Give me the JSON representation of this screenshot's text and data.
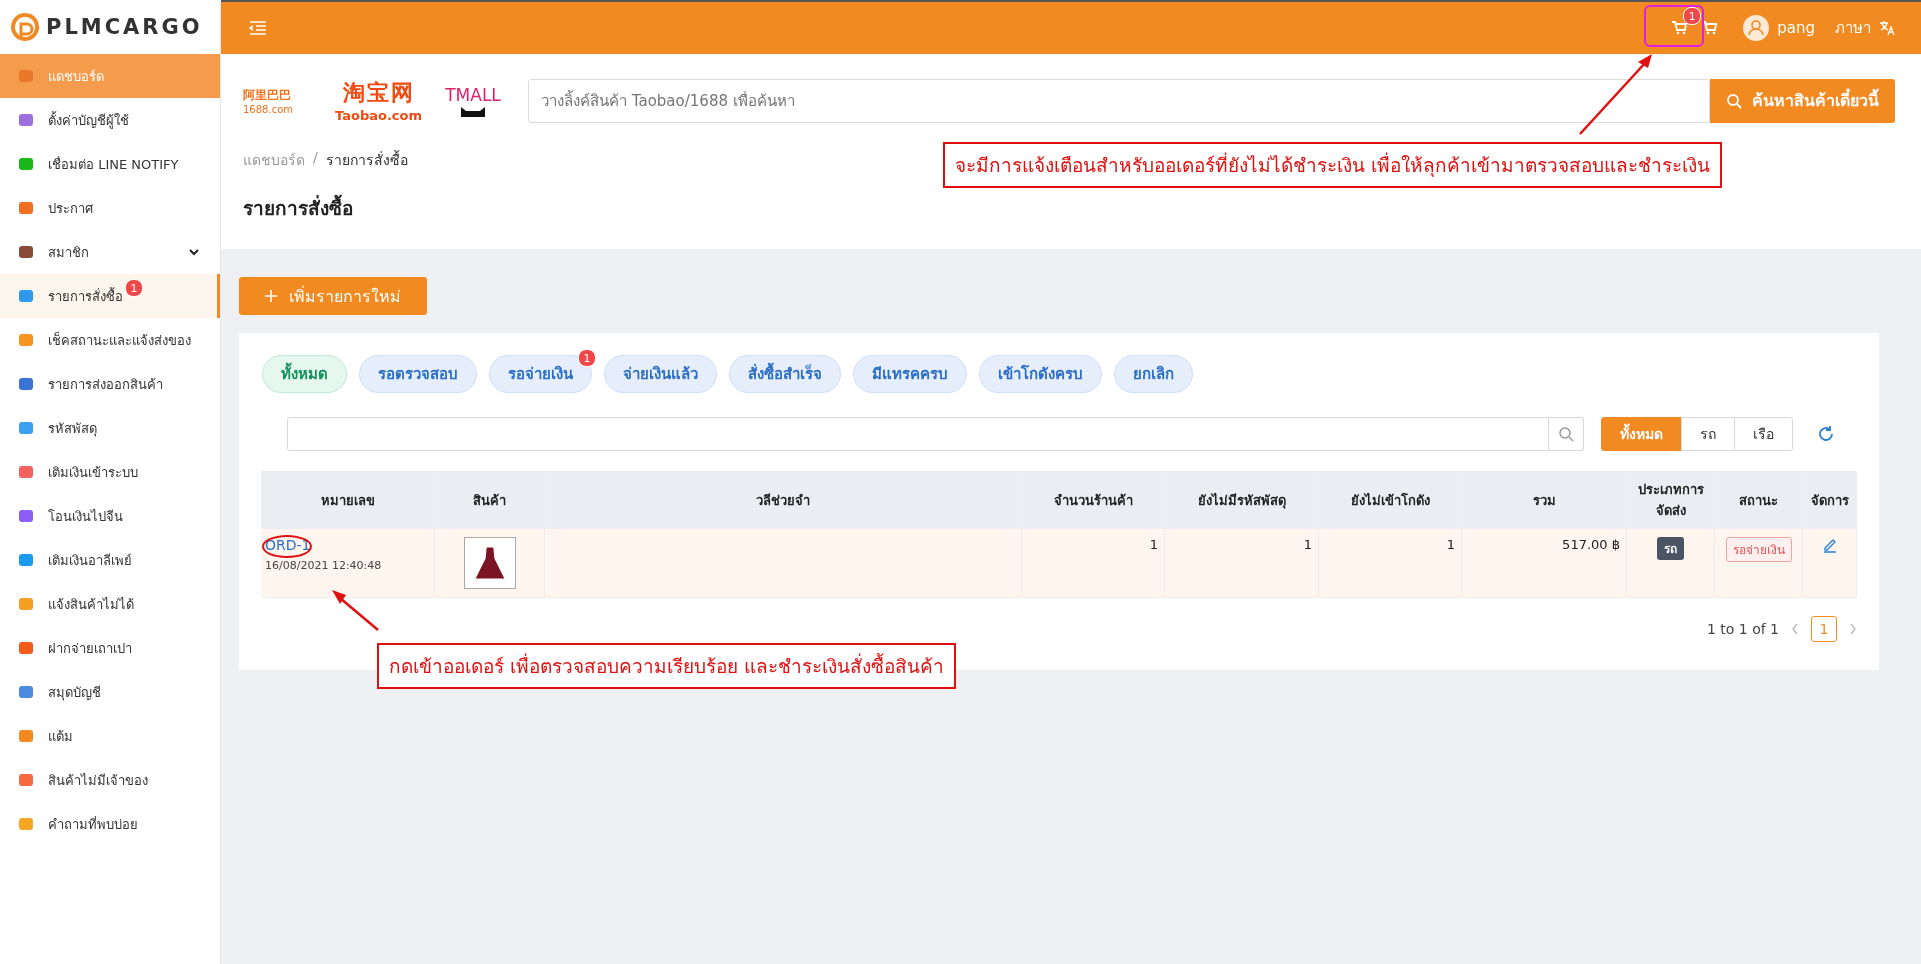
{
  "brand": {
    "name": "PLMCARGO"
  },
  "sidebar": {
    "items": [
      {
        "label": "แดชบอร์ด",
        "kind": "link",
        "highlighted": true,
        "selected": false
      },
      {
        "label": "ตั้งค่าบัญชีผู้ใช้",
        "kind": "link",
        "highlighted": false,
        "selected": false
      },
      {
        "label": "เชื่อมต่อ LINE NOTIFY",
        "kind": "link",
        "highlighted": false,
        "selected": false
      },
      {
        "label": "ประกาศ",
        "kind": "link",
        "highlighted": false,
        "selected": false
      },
      {
        "label": "สมาชิก",
        "kind": "group",
        "expanded": false,
        "highlighted": false,
        "selected": false
      },
      {
        "label": "รายการสั่งซื้อ",
        "kind": "link",
        "badge": "1",
        "highlighted": false,
        "selected": true
      },
      {
        "label": "เช็คสถานะและแจ้งส่งของ",
        "kind": "link",
        "highlighted": false,
        "selected": false
      },
      {
        "label": "รายการส่งออกสินค้า",
        "kind": "link",
        "highlighted": false,
        "selected": false
      },
      {
        "label": "รหัสพัสดุ",
        "kind": "link",
        "highlighted": false,
        "selected": false
      },
      {
        "label": "เติมเงินเข้าระบบ",
        "kind": "link",
        "highlighted": false,
        "selected": false
      },
      {
        "label": "โอนเงินไปจีน",
        "kind": "link",
        "highlighted": false,
        "selected": false
      },
      {
        "label": "เติมเงินอาลีเพย์",
        "kind": "link",
        "highlighted": false,
        "selected": false
      },
      {
        "label": "แจ้งสินค้าไม่ได้",
        "kind": "link",
        "highlighted": false,
        "selected": false
      },
      {
        "label": "ฝากจ่ายเถาเปา",
        "kind": "link",
        "highlighted": false,
        "selected": false
      },
      {
        "label": "สมุดบัญชี",
        "kind": "link",
        "highlighted": false,
        "selected": false
      },
      {
        "label": "แต้ม",
        "kind": "link",
        "highlighted": false,
        "selected": false
      },
      {
        "label": "สินค้าไม่มีเจ้าของ",
        "kind": "link",
        "highlighted": false,
        "selected": false
      },
      {
        "label": "คำถามที่พบบ่อย",
        "kind": "link",
        "highlighted": false,
        "selected": false
      }
    ]
  },
  "topbar": {
    "cart_badge": "1",
    "user": "pang",
    "language": "ภาษา"
  },
  "logos": {
    "alibaba": "阿里巴巴",
    "alibaba_sub": "1688.com",
    "taobao": "淘宝网",
    "taobao_sub": "Taobao.com",
    "tmall": "TMALL"
  },
  "search": {
    "placeholder": "วางลิ้งค์สินค้า Taobao/1688 เพื่อค้นหา",
    "button": "ค้นหาสินค้าเดี๋ยวนี้"
  },
  "breadcrumb": [
    "แดชบอร์ด",
    "รายการสั่งซื้อ"
  ],
  "breadcrumb_separator": "/",
  "page_title": "รายการสั่งซื้อ",
  "add_button": "เพิ่มรายการใหม่",
  "status_tabs": [
    {
      "label": "ทั้งหมด",
      "selected": true
    },
    {
      "label": "รอตรวจสอบ",
      "selected": false
    },
    {
      "label": "รอจ่ายเงิน",
      "selected": false,
      "badge": "1"
    },
    {
      "label": "จ่ายเงินแล้ว",
      "selected": false
    },
    {
      "label": "สั่งซื้อสำเร็จ",
      "selected": false
    },
    {
      "label": "มีแทรคครบ",
      "selected": false
    },
    {
      "label": "เข้าโกดังครบ",
      "selected": false
    },
    {
      "label": "ยกเลิก",
      "selected": false
    }
  ],
  "transport_filter": [
    {
      "label": "ทั้งหมด",
      "selected": true
    },
    {
      "label": "รถ",
      "selected": false
    },
    {
      "label": "เรือ",
      "selected": false
    }
  ],
  "table": {
    "columns": [
      "หมายเลข",
      "สินค้า",
      "วลีช่วยจำ",
      "จำนวนร้านค้า",
      "ยังไม่มีรหัสพัสดุ",
      "ยังไม่เข้าโกดัง",
      "รวม",
      "ประเภทการจัดส่ง",
      "สถานะ",
      "จัดการ"
    ],
    "rows": [
      {
        "order": "ORD-1",
        "date": "16/08/2021 12:40:48",
        "shops": "1",
        "no_tracking": "1",
        "not_in_warehouse": "1",
        "total": "517.00 ฿",
        "shipping": "รถ",
        "status": "รอจ่ายเงิน"
      }
    ]
  },
  "pagination": {
    "summary": "1 to 1 of 1",
    "pages": [
      {
        "label": "1",
        "selected": true
      }
    ]
  },
  "annotations": [
    "จะมีการแจ้งเตือนสำหรับออเดอร์ที่ยังไม่ได้ชำระเงิน เพื่อให้ลุกค้าเข้ามาตรวจสอบและชำระเงิน",
    "กดเข้าออเดอร์ เพื่อตรวจสอบความเรียบร้อย และชำระเงินสั่งซื้อสินค้า"
  ]
}
